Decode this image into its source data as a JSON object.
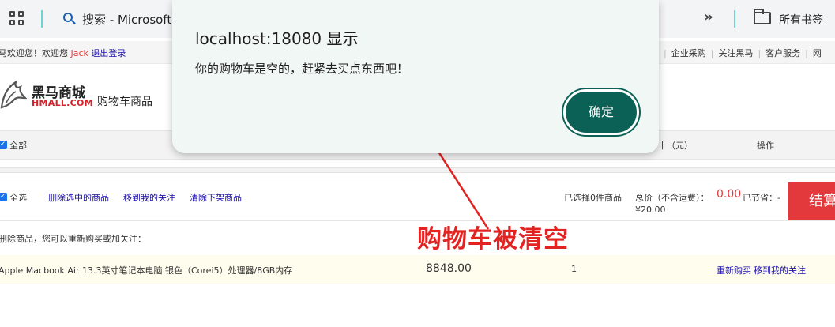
{
  "browser": {
    "omnibox_text": "搜索 - Microsoft",
    "bookmarks_label": "所有书签",
    "icons": [
      "apps-grid-icon",
      "search-icon",
      "chevron-double-right-icon",
      "folder-icon"
    ]
  },
  "site": {
    "welcome_prefix": "马欢迎您！欢迎您 ",
    "username": "Jack",
    "logout": "退出登录",
    "top_links": [
      "企业采购",
      "关注黑马",
      "客户服务",
      "网"
    ],
    "logo_cn": "黑马商城",
    "logo_en": "HMALL.COM",
    "page_title": "购物车商品"
  },
  "cart": {
    "select_all": "全部",
    "col_subtotal": "十（元）",
    "col_action": "操作",
    "select_all_bottom": "全选",
    "actions": [
      "删除选中的商品",
      "移到我的关注",
      "清除下架商品"
    ],
    "selected_count": "已选择0件商品",
    "total_label": "总价（不含运费）：",
    "total_value": "0.00",
    "saved_label": "已节省：-",
    "saved_value": "¥20.00",
    "checkout": "结算"
  },
  "removed": {
    "note": "删除商品，您可以重新购买或加关注：",
    "item_name": "Apple Macbook Air 13.3英寸笔记本电脑 银色（Corei5）处理器/8GB内存",
    "price": "8848.00",
    "qty": "1",
    "rebuy": "重新购买",
    "follow": "移到我的关注"
  },
  "annotation": {
    "text": "购物车被清空",
    "color": "#e32222"
  },
  "dialog": {
    "title": "localhost:18080 显示",
    "message": "你的购物车是空的，赶紧去买点东西吧！",
    "ok": "确定",
    "accent": "#0b6156"
  }
}
